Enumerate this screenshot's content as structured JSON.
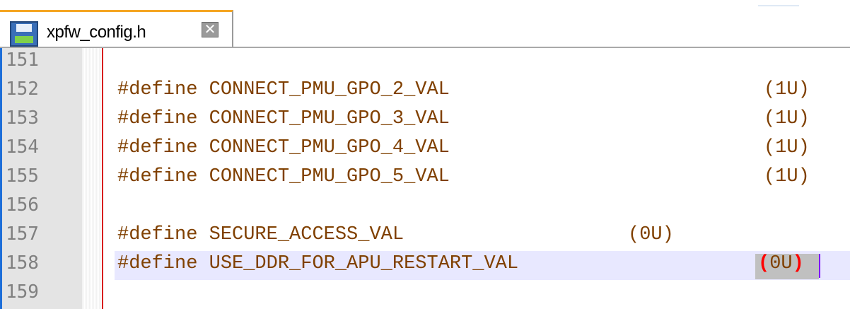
{
  "tab": {
    "title": "xpfw_config.h",
    "icon": "floppy-disk-icon",
    "close_icon": "close-icon",
    "close_glyph": "✕"
  },
  "editor": {
    "lines": [
      {
        "num": "151",
        "code": "",
        "value": ""
      },
      {
        "num": "152",
        "code": "#define CONNECT_PMU_GPO_2_VAL",
        "value": "(1U)"
      },
      {
        "num": "153",
        "code": "#define CONNECT_PMU_GPO_3_VAL",
        "value": "(1U)"
      },
      {
        "num": "154",
        "code": "#define CONNECT_PMU_GPO_4_VAL",
        "value": "(1U)"
      },
      {
        "num": "155",
        "code": "#define CONNECT_PMU_GPO_5_VAL",
        "value": "(1U)"
      },
      {
        "num": "156",
        "code": "",
        "value": ""
      },
      {
        "num": "157",
        "code": "#define SECURE_ACCESS_VAL",
        "value": "(0U)"
      },
      {
        "num": "158",
        "code": "#define USE_DDR_FOR_APU_RESTART_VAL",
        "value_open": "(",
        "value_inner": "0U",
        "value_close": ")"
      },
      {
        "num": "159",
        "code": "",
        "value": ""
      }
    ]
  },
  "colors": {
    "code_text": "#804000",
    "line_numbers": "#808080",
    "brace_match": "#ff0000",
    "current_line": "#e8e8ff",
    "edge_line": "#d81e1e",
    "tab_accent": "#f5a623"
  }
}
